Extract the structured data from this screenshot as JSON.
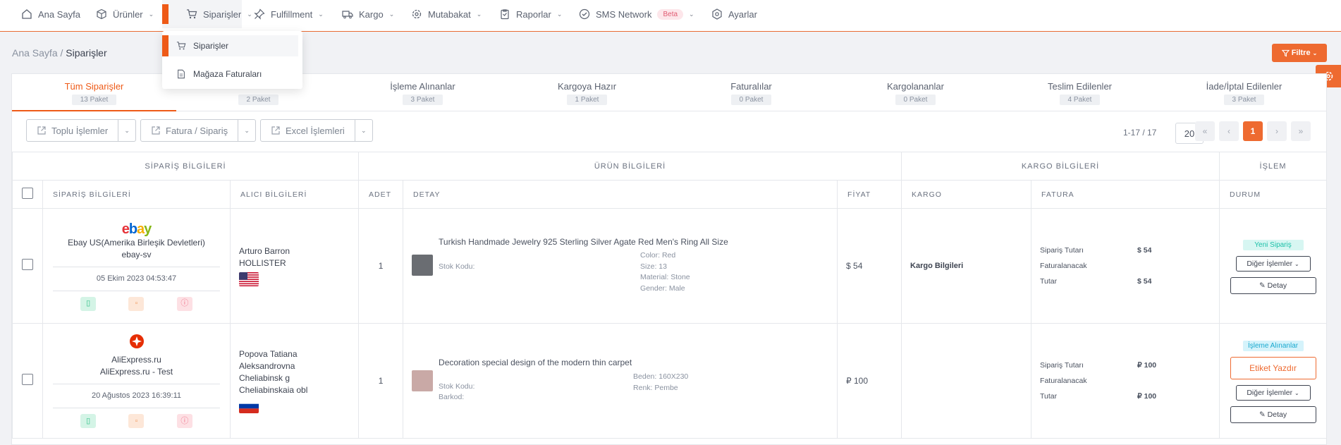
{
  "nav": {
    "items": [
      {
        "label": "Ana Sayfa",
        "icon": "home-icon"
      },
      {
        "label": "Ürünler",
        "icon": "box-icon"
      },
      {
        "label": "Siparişler",
        "icon": "cart-icon"
      },
      {
        "label": "Fulfillment",
        "icon": "pin-icon"
      },
      {
        "label": "Kargo",
        "icon": "truck-icon"
      },
      {
        "label": "Mutabakat",
        "icon": "gear-icon"
      },
      {
        "label": "Raporlar",
        "icon": "clipboard-icon"
      },
      {
        "label": "SMS Network",
        "icon": "check-circle-icon",
        "badge": "Beta"
      },
      {
        "label": "Ayarlar",
        "icon": "settings-icon"
      }
    ]
  },
  "dropdown": {
    "items": [
      "Siparişler",
      "Mağaza Faturaları"
    ]
  },
  "breadcrumb": {
    "home": "Ana Sayfa",
    "sep": "/",
    "current": "Siparişler"
  },
  "filter_label": "Filtre",
  "tabs": [
    {
      "label": "Tüm Siparişler",
      "count": "13 Paket"
    },
    {
      "label": "",
      "count": "2 Paket"
    },
    {
      "label": "İşleme Alınanlar",
      "count": "3 Paket"
    },
    {
      "label": "Kargoya Hazır",
      "count": "1 Paket"
    },
    {
      "label": "Faturalılar",
      "count": "0 Paket"
    },
    {
      "label": "Kargolananlar",
      "count": "0 Paket"
    },
    {
      "label": "Teslim Edilenler",
      "count": "4 Paket"
    },
    {
      "label": "İade/İptal Edilenler",
      "count": "3 Paket"
    }
  ],
  "toolbar": {
    "bulk": "Toplu İşlemler",
    "invoice": "Fatura / Sipariş",
    "excel": "Excel İşlemleri"
  },
  "pager": {
    "range": "1-17 / 17",
    "size": "20",
    "current": "1",
    "first": "«",
    "prev": "‹",
    "next": "›",
    "last": "»"
  },
  "table": {
    "groups": [
      "SİPARİŞ BİLGİLERİ",
      "ÜRÜN BİLGİLERİ",
      "KARGO BİLGİLERİ",
      "İŞLEM"
    ],
    "headers": [
      "SİPARİŞ BİLGİLERİ",
      "ALICI BİLGİLERİ",
      "ADET",
      "DETAY",
      "FİYAT",
      "KARGO",
      "FATURA",
      "DURUM"
    ],
    "rows": [
      {
        "store_logo": "ebay",
        "store_name": "Ebay US(Amerika Birleşik Devletleri)",
        "store_id": "ebay-sv",
        "date": "05 Ekim 2023 04:53:47",
        "buyer_name": "Arturo Barron",
        "buyer_line2": "HOLLISTER",
        "buyer_line3": "",
        "buyer_line4": "",
        "flag": "us-flag",
        "qty": "1",
        "product": "Turkish Handmade Jewelry 925 Sterling Silver Agate Red Men's Ring All Size",
        "stock_label": "Stok Kodu:",
        "barcode_label": "",
        "vars": [
          "Color: Red",
          "Size: 13",
          "Material: Stone",
          "Gender: Male"
        ],
        "price": "$ 54",
        "kargo": "Kargo Bilgileri",
        "fat_label1": "Sipariş Tutarı",
        "fat_value1": "$ 54",
        "fat_label2": "Faturalanacak Tutar",
        "fat_value2": "$ 54",
        "status": "Yeni Sipariş",
        "other_ops": "Diğer İşlemler",
        "detail": "Detay"
      },
      {
        "store_logo": "aliexpress",
        "store_name": "AliExpress.ru",
        "store_id": "AliExpress.ru - Test",
        "date": "20 Ağustos 2023 16:39:11",
        "buyer_name": "Popova Tatiana",
        "buyer_line2": "Aleksandrovna",
        "buyer_line3": "Cheliabinsk g",
        "buyer_line4": "Cheliabinskaia obl",
        "flag": "ru-flag",
        "qty": "1",
        "product": "Decoration special design of the modern thin carpet",
        "stock_label": "Stok Kodu:",
        "barcode_label": "Barkod:",
        "vars": [
          "Beden: 160X230",
          "Renk: Pembe"
        ],
        "price": "₽ 100",
        "kargo": "",
        "fat_label1": "Sipariş Tutarı",
        "fat_value1": "₽ 100",
        "fat_label2": "Faturalanacak Tutar",
        "fat_value2": "₽ 100",
        "status": "İşleme Alınanlar",
        "print_label": "Etiket Yazdır",
        "other_ops": "Diğer İşlemler",
        "detail": "Detay"
      }
    ]
  },
  "colors": {
    "accent": "#ee6a30",
    "nav_active": "#ee5a17",
    "new_badge": "#1cc0a8",
    "proc_badge": "#1aa9cf"
  }
}
